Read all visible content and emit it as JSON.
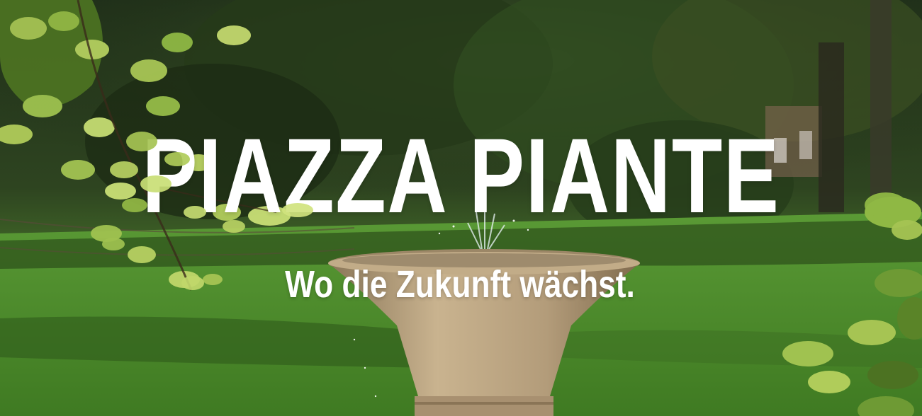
{
  "hero": {
    "title": "PIAZZA PIANTE",
    "subtitle": "Wo die Zukunft wächst."
  },
  "background": {
    "scene": "park-fountain-photo",
    "colors": {
      "lawn": "#4f8a2c",
      "foliage_dark": "#1f3015",
      "stone": "#b39c7a",
      "text": "#ffffff"
    }
  }
}
